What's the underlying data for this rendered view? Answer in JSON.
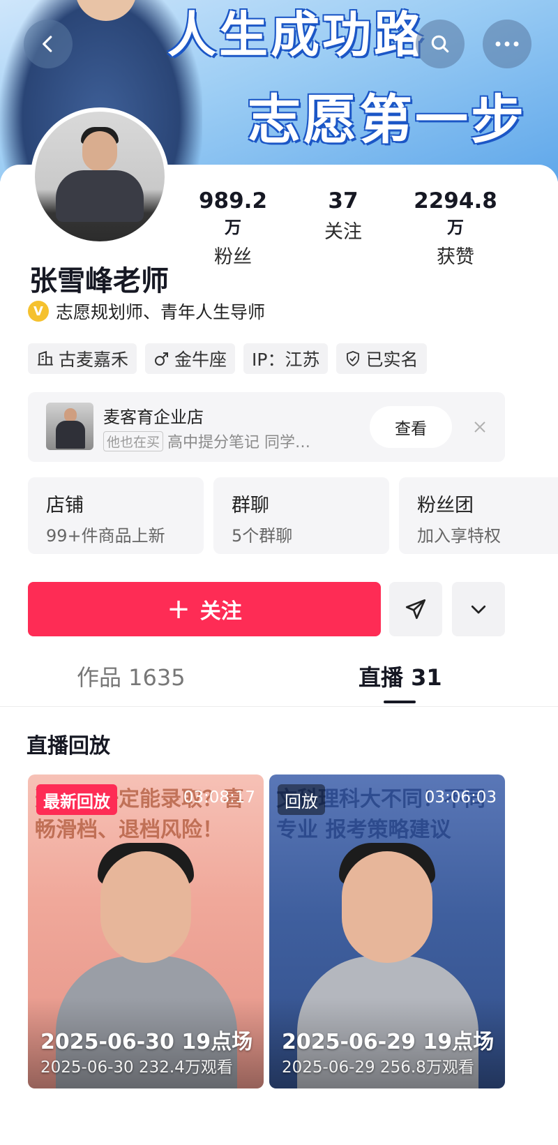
{
  "banner": {
    "line1": "人生成功路",
    "line2": "志愿第一步"
  },
  "profile": {
    "stats": [
      {
        "value": "989.2",
        "unit": "万",
        "label": "粉丝"
      },
      {
        "value": "37",
        "unit": "",
        "label": "关注"
      },
      {
        "value": "2294.8",
        "unit": "万",
        "label": "获赞"
      }
    ],
    "name": "张雪峰老师",
    "verify_badge": "V",
    "verify_text": "志愿规划师、青年人生导师",
    "tags": [
      "古麦嘉禾",
      "金牛座",
      "IP：江苏",
      "已实名"
    ]
  },
  "shop_row": {
    "name": "麦客育企业店",
    "pill": "他也在买",
    "sub": "高中提分笔记 同学…",
    "view_label": "查看"
  },
  "quick_links": [
    {
      "title": "店铺",
      "sub": "99+件商品上新"
    },
    {
      "title": "群聊",
      "sub": "5个群聊"
    },
    {
      "title": "粉丝团",
      "sub": "加入享特权"
    }
  ],
  "actions": {
    "follow_label": "关注"
  },
  "tabs": {
    "works": "作品 1635",
    "live": "直播 31"
  },
  "section_title": "直播回放",
  "replays": [
    {
      "badge": "最新回放",
      "duration": "03:08:17",
      "poster_text": "选填不一定能录取？喜畅滑档、退档风险！",
      "title": "2025-06-30 19点场",
      "meta": "2025-06-30  232.4万观看"
    },
    {
      "badge": "回放",
      "duration": "03:06:03",
      "poster_text": "文科理科大不同！不同专业 报考策略建议",
      "title": "2025-06-29 19点场",
      "meta": "2025-06-29  256.8万观看"
    }
  ]
}
